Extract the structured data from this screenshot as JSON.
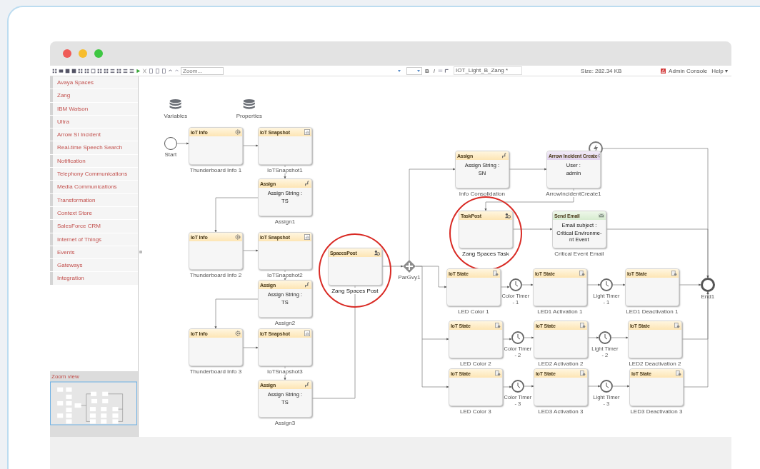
{
  "window": {
    "title_lights": true
  },
  "toolbar": {
    "zoom_placeholder": "Zoom...",
    "bold": "B",
    "italic": "I",
    "file_name": "IOT_Light_B_Zang *",
    "size": "Size: 282.34 KB",
    "admin_console": "Admin Console",
    "help": "Help ▾"
  },
  "sidebar": {
    "items": [
      {
        "label": "Avaya Spaces"
      },
      {
        "label": "Zang"
      },
      {
        "label": "IBM Watson"
      },
      {
        "label": "Ultra"
      },
      {
        "label": "Arrow SI Incident"
      },
      {
        "label": "Real-time Speech Search"
      },
      {
        "label": "Notification"
      },
      {
        "label": "Telephony Communications"
      },
      {
        "label": "Media Communications"
      },
      {
        "label": "Transformation"
      },
      {
        "label": "Context Store"
      },
      {
        "label": "SalesForce CRM"
      },
      {
        "label": "Internet of Things"
      },
      {
        "label": "Events"
      },
      {
        "label": "Gateways"
      },
      {
        "label": "Integration"
      }
    ],
    "zoom_view": {
      "title": "Zoom view"
    }
  },
  "diagram": {
    "data_stores": [
      "Variables",
      "Properties"
    ],
    "start": "Start",
    "end": "End1",
    "gateway": "ParGvy1",
    "tasks": [
      {
        "kind": "iot-info",
        "type": "IoT Info",
        "label": "Thunderboard Info 1",
        "highlighted": false
      },
      {
        "kind": "iot-snapshot",
        "type": "IoT Snapshot",
        "label": "IoTSnapshot1",
        "highlighted": false
      },
      {
        "kind": "assign",
        "type": "Assign",
        "body": [
          "Assign String :",
          "TS"
        ],
        "label": "Assign1",
        "highlighted": false
      },
      {
        "kind": "iot-info",
        "type": "IoT Info",
        "label": "Thunderboard Info 2",
        "highlighted": false
      },
      {
        "kind": "iot-snapshot",
        "type": "IoT Snapshot",
        "label": "IoTSnapshot2",
        "highlighted": false
      },
      {
        "kind": "assign",
        "type": "Assign",
        "body": [
          "Assign String :",
          "TS"
        ],
        "label": "Assign2",
        "highlighted": false
      },
      {
        "kind": "iot-info",
        "type": "IoT Info",
        "label": "Thunderboard Info 3",
        "highlighted": false
      },
      {
        "kind": "iot-snapshot",
        "type": "IoT Snapshot",
        "label": "IoTSnapshot3",
        "highlighted": false
      },
      {
        "kind": "assign",
        "type": "Assign",
        "body": [
          "Assign String :",
          "TS"
        ],
        "label": "Assign3",
        "highlighted": false
      },
      {
        "kind": "spaces-post",
        "type": "SpacesPost",
        "label": "Zang Spaces Post",
        "highlighted": true
      },
      {
        "kind": "assign",
        "type": "Assign",
        "body": [
          "Assign String :",
          "SN"
        ],
        "label": "Info Consolidation",
        "highlighted": false
      },
      {
        "kind": "incident",
        "type": "Arrow Incident Create",
        "body": [
          "User :",
          "admin"
        ],
        "label": "ArrowIncidentCreate1",
        "highlighted": false
      },
      {
        "kind": "spaces-post",
        "type": "TaskPost",
        "label": "Zang Spaces Task",
        "highlighted": true
      },
      {
        "kind": "email",
        "type": "Send Email",
        "body": [
          "Email subject :",
          "Critical Environme-\nnt Event"
        ],
        "label": "Critical Event Email",
        "highlighted": false
      },
      {
        "kind": "iot-state",
        "type": "IoT State",
        "label": "LED Color 1",
        "highlighted": false
      },
      {
        "kind": "iot-state",
        "type": "IoT State",
        "label": "LED1 Activation 1",
        "highlighted": false
      },
      {
        "kind": "iot-state",
        "type": "IoT State",
        "label": "LED1 Deactivation 1",
        "highlighted": false
      },
      {
        "kind": "iot-state",
        "type": "IoT State",
        "label": "LED Color 2",
        "highlighted": false
      },
      {
        "kind": "iot-state",
        "type": "IoT State",
        "label": "LED2 Activation 2",
        "highlighted": false
      },
      {
        "kind": "iot-state",
        "type": "IoT State",
        "label": "LED2 Deactivation 2",
        "highlighted": false
      },
      {
        "kind": "iot-state",
        "type": "IoT State",
        "label": "LED Color 3",
        "highlighted": false
      },
      {
        "kind": "iot-state",
        "type": "IoT State",
        "label": "LED3 Activation 3",
        "highlighted": false
      },
      {
        "kind": "iot-state",
        "type": "IoT State",
        "label": "LED3 Deactivation 3",
        "highlighted": false
      }
    ],
    "timers": [
      "Color Timer - 1",
      "Light Timer - 1",
      "Color Timer - 2",
      "Light Timer - 2",
      "Color Timer - 3",
      "Light Timer - 3"
    ]
  }
}
